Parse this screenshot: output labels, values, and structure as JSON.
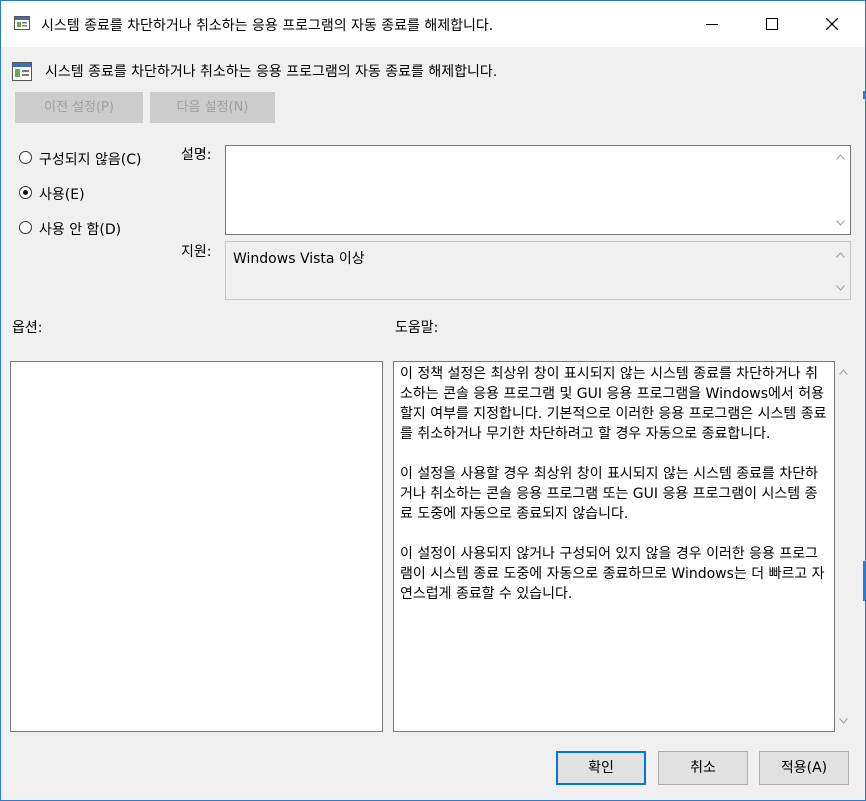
{
  "window": {
    "title": "시스템 종료를 차단하거나 취소하는 응용 프로그램의 자동 종료를 해제합니다.",
    "controls": [
      "minimize",
      "maximize",
      "close"
    ]
  },
  "header": {
    "policy_title": "시스템 종료를 차단하거나 취소하는 응용 프로그램의 자동 종료를 해제합니다.",
    "icon": "policy-setting-icon"
  },
  "nav": {
    "prev_label": "이전 설정(P)",
    "next_label": "다음 설정(N)"
  },
  "state": {
    "options": [
      {
        "label": "구성되지 않음(C)",
        "selected": false
      },
      {
        "label": "사용(E)",
        "selected": true
      },
      {
        "label": "사용 안 함(D)",
        "selected": false
      }
    ]
  },
  "comment": {
    "label": "설명:",
    "value": ""
  },
  "supported": {
    "label": "지원:",
    "value": "Windows Vista 이상"
  },
  "options_panel": {
    "label": "옵션:"
  },
  "help_panel": {
    "label": "도움말:",
    "paragraphs": [
      "이 정책 설정은 최상위 창이 표시되지 않는 시스템 종료를 차단하거나 취소하는 콘솔 응용 프로그램 및 GUI 응용 프로그램을 Windows에서 허용할지 여부를 지정합니다. 기본적으로 이러한 응용 프로그램은 시스템 종료를 취소하거나 무기한 차단하려고 할 경우 자동으로 종료합니다.",
      "이 설정을 사용할 경우 최상위 창이 표시되지 않는 시스템 종료를 차단하거나 취소하는 콘솔 응용 프로그램 또는 GUI 응용 프로그램이 시스템 종료 도중에 자동으로 종료되지 않습니다.",
      "이 설정이 사용되지 않거나 구성되어 있지 않을 경우 이러한 응용 프로그램이 시스템 종료 도중에 자동으로 종료하므로 Windows는 더 빠르고 자연스럽게 종료할 수 있습니다."
    ]
  },
  "buttons": {
    "ok": "확인",
    "cancel": "취소",
    "apply": "적용(A)"
  },
  "colors": {
    "accent": "#0078d7",
    "window_border": "#2b7bd6",
    "dialog_bg": "#f0f0f0"
  }
}
